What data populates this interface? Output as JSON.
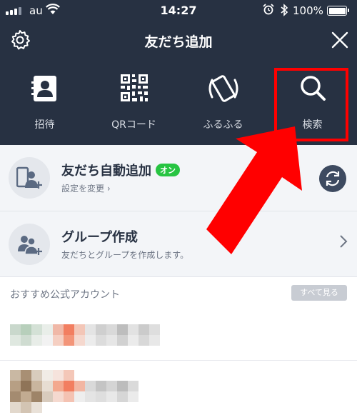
{
  "status_bar": {
    "carrier": "au",
    "time": "14:27",
    "battery": "100%"
  },
  "nav": {
    "title": "友だち追加",
    "settings_icon": "gear-icon",
    "close_icon": "close-icon"
  },
  "actions": [
    {
      "label": "招待",
      "icon": "contact-book-icon"
    },
    {
      "label": "QRコード",
      "icon": "qr-code-icon"
    },
    {
      "label": "ふるふる",
      "icon": "shake-phone-icon"
    },
    {
      "label": "検索",
      "icon": "search-icon"
    }
  ],
  "auto_add": {
    "title": "友だち自動追加",
    "badge": "オン",
    "subtitle": "設定を変更",
    "subtitle_chevron": "›"
  },
  "group": {
    "title": "グループ作成",
    "subtitle": "友だちとグループを作成します。"
  },
  "recommended": {
    "header": "おすすめ公式アカウント",
    "see_all": "すべて見る"
  },
  "colors": {
    "header_bg": "#273142",
    "highlight_red": "#ff0000",
    "badge_green": "#27c442"
  }
}
